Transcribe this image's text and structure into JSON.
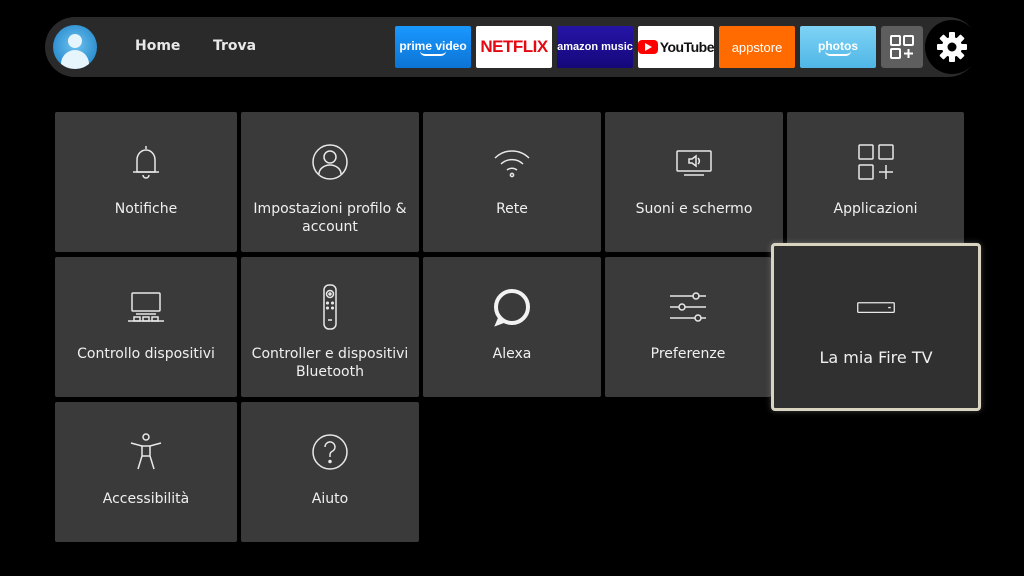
{
  "topbar": {
    "nav": {
      "home": "Home",
      "find": "Trova"
    },
    "apps": {
      "prime": "prime video",
      "netflix": "NETFLIX",
      "amazon_music": "amazon music",
      "youtube": "YouTube",
      "appstore": "appstore",
      "photos": "photos"
    }
  },
  "settings": [
    {
      "label": "Notifiche",
      "icon": "bell-icon"
    },
    {
      "label": "Impostazioni profilo & account",
      "icon": "profile-icon"
    },
    {
      "label": "Rete",
      "icon": "wifi-icon"
    },
    {
      "label": "Suoni e schermo",
      "icon": "display-sound-icon"
    },
    {
      "label": "Applicazioni",
      "icon": "apps-grid-icon"
    },
    {
      "label": "Controllo dispositivi",
      "icon": "tv-devices-icon"
    },
    {
      "label": "Controller e dispositivi Bluetooth",
      "icon": "remote-icon"
    },
    {
      "label": "Alexa",
      "icon": "alexa-ring-icon"
    },
    {
      "label": "Preferenze",
      "icon": "sliders-icon"
    },
    {
      "label": "La mia Fire TV",
      "icon": "fire-tv-device-icon"
    },
    {
      "label": "Accessibilità",
      "icon": "accessibility-icon"
    },
    {
      "label": "Aiuto",
      "icon": "help-icon"
    }
  ],
  "colors": {
    "focus_border": "#d9d4c0",
    "tile_bg": "#3a3a3a",
    "topbar_bg": "#2a2a2a"
  }
}
